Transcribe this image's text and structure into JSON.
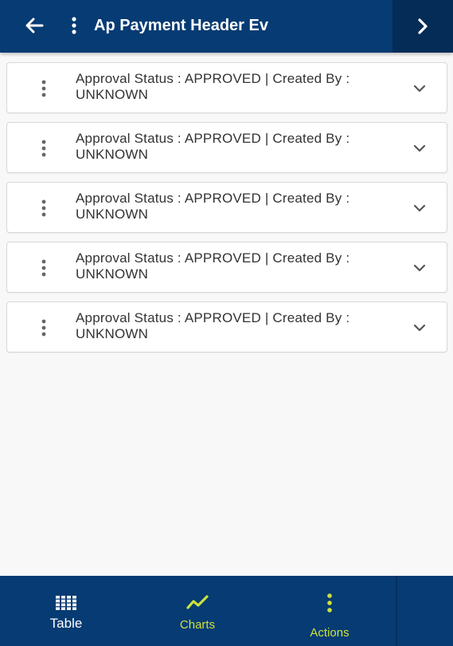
{
  "colors": {
    "header_bg": "#063b73",
    "accent": "#cde23c",
    "card_bg": "#ffffff",
    "page_bg": "#f8f8f8"
  },
  "header": {
    "title": "Ap Payment Header Ev",
    "back_icon": "arrow-left-icon",
    "menu_icon": "more-vertical-icon",
    "next_icon": "chevron-right-icon"
  },
  "records": [
    {
      "line1": "Approval Status  : APPROVED | Created By  :",
      "line2": "UNKNOWN"
    },
    {
      "line1": "Approval Status  : APPROVED | Created By  :",
      "line2": "UNKNOWN"
    },
    {
      "line1": "Approval Status  : APPROVED | Created By  :",
      "line2": "UNKNOWN"
    },
    {
      "line1": "Approval Status  : APPROVED | Created By  :",
      "line2": "UNKNOWN"
    },
    {
      "line1": "Approval Status  : APPROVED | Created By  :",
      "line2": "UNKNOWN"
    }
  ],
  "bottom_nav": {
    "table_label": "Table",
    "charts_label": "Charts",
    "actions_label": "Actions",
    "table_icon": "grid-icon",
    "charts_icon": "trend-line-icon",
    "actions_icon": "more-vertical-icon"
  }
}
